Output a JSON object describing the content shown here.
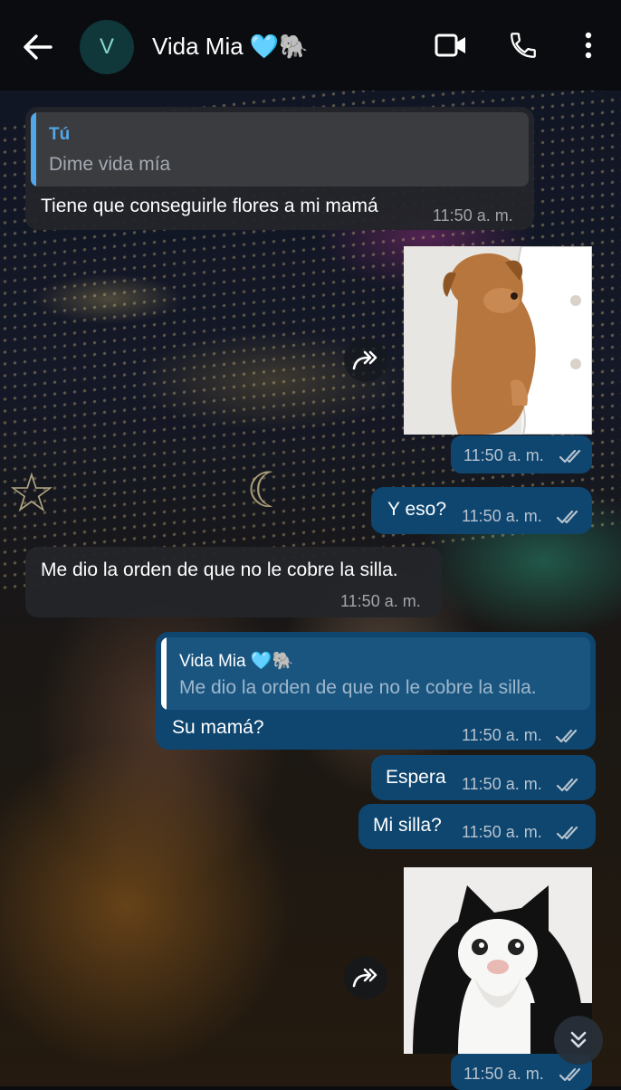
{
  "header": {
    "avatar_letter": "V",
    "contact_name": "Vida Mia 🩵🐘",
    "icons": [
      "back-arrow-icon",
      "video-call-icon",
      "phone-icon",
      "more-vert-icon"
    ]
  },
  "colors": {
    "header_bg": "#0b0c0f",
    "incoming_bubble": "#232529",
    "outgoing_bubble": "#0e466f",
    "quote_accent": "#53a7e8",
    "timestamp": "#b7c3cf"
  },
  "messages": [
    {
      "direction": "in",
      "quote_author": "Tú",
      "quote_text": "Dime vida mía",
      "text": "Tiene que conseguirle flores a mi mamá",
      "time": "11:50 a. m."
    },
    {
      "direction": "out",
      "type": "sticker",
      "sticker": "sad dog hugging furniture",
      "time": "11:50 a. m.",
      "status": "read"
    },
    {
      "direction": "out",
      "text": "Y eso?",
      "time": "11:50 a. m.",
      "status": "read"
    },
    {
      "direction": "in",
      "text": "Me dio la orden de que no le cobre la silla.",
      "time": "11:50 a. m."
    },
    {
      "direction": "out",
      "quote_author": "Vida Mia 🩵🐘",
      "quote_text": "Me dio la orden de que no le cobre la silla.",
      "text": "Su mamá?",
      "time": "11:50 a. m.",
      "status": "read"
    },
    {
      "direction": "out",
      "text": "Espera",
      "time": "11:50 a. m.",
      "status": "read"
    },
    {
      "direction": "out",
      "text": "Mi silla?",
      "time": "11:50 a. m.",
      "status": "read"
    },
    {
      "direction": "out",
      "type": "sticker",
      "sticker": "crying cat",
      "time": "11:50 a. m.",
      "status": "read"
    }
  ]
}
